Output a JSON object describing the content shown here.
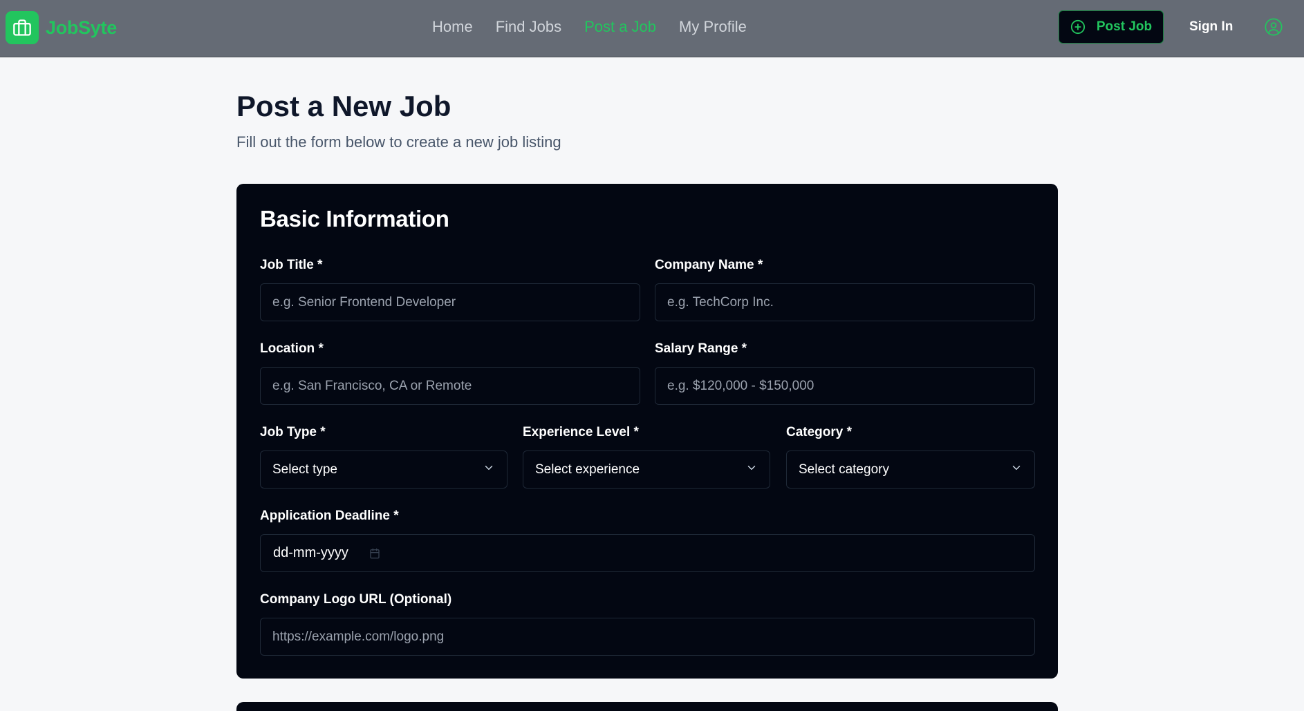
{
  "header": {
    "brand": "JobSyte",
    "nav": [
      {
        "label": "Home",
        "active": false
      },
      {
        "label": "Find Jobs",
        "active": false
      },
      {
        "label": "Post a Job",
        "active": true
      },
      {
        "label": "My Profile",
        "active": false
      }
    ],
    "post_button": "Post Job",
    "sign_in": "Sign In"
  },
  "page": {
    "title": "Post a New Job",
    "subtitle": "Fill out the form below to create a new job listing"
  },
  "form": {
    "section_title": "Basic Information",
    "job_title": {
      "label": "Job Title *",
      "placeholder": "e.g. Senior Frontend Developer",
      "value": ""
    },
    "company_name": {
      "label": "Company Name *",
      "placeholder": "e.g. TechCorp Inc.",
      "value": ""
    },
    "location": {
      "label": "Location *",
      "placeholder": "e.g. San Francisco, CA or Remote",
      "value": ""
    },
    "salary_range": {
      "label": "Salary Range *",
      "placeholder": "e.g. $120,000 - $150,000",
      "value": ""
    },
    "job_type": {
      "label": "Job Type *",
      "selected": "Select type"
    },
    "experience_level": {
      "label": "Experience Level *",
      "selected": "Select experience"
    },
    "category": {
      "label": "Category *",
      "selected": "Select category"
    },
    "deadline": {
      "label": "Application Deadline *",
      "value": "dd-mm-yyyy"
    },
    "logo_url": {
      "label": "Company Logo URL (Optional)",
      "placeholder": "https://example.com/logo.png",
      "value": ""
    }
  },
  "colors": {
    "accent": "#22c55e",
    "header_bg": "#656b75",
    "card_bg": "#030712",
    "page_bg": "#f6f7f9"
  },
  "icons": {
    "logo": "briefcase-icon",
    "post_button": "plus-circle-icon",
    "avatar": "user-icon",
    "select": "chevron-down-icon",
    "date": "calendar-icon"
  }
}
